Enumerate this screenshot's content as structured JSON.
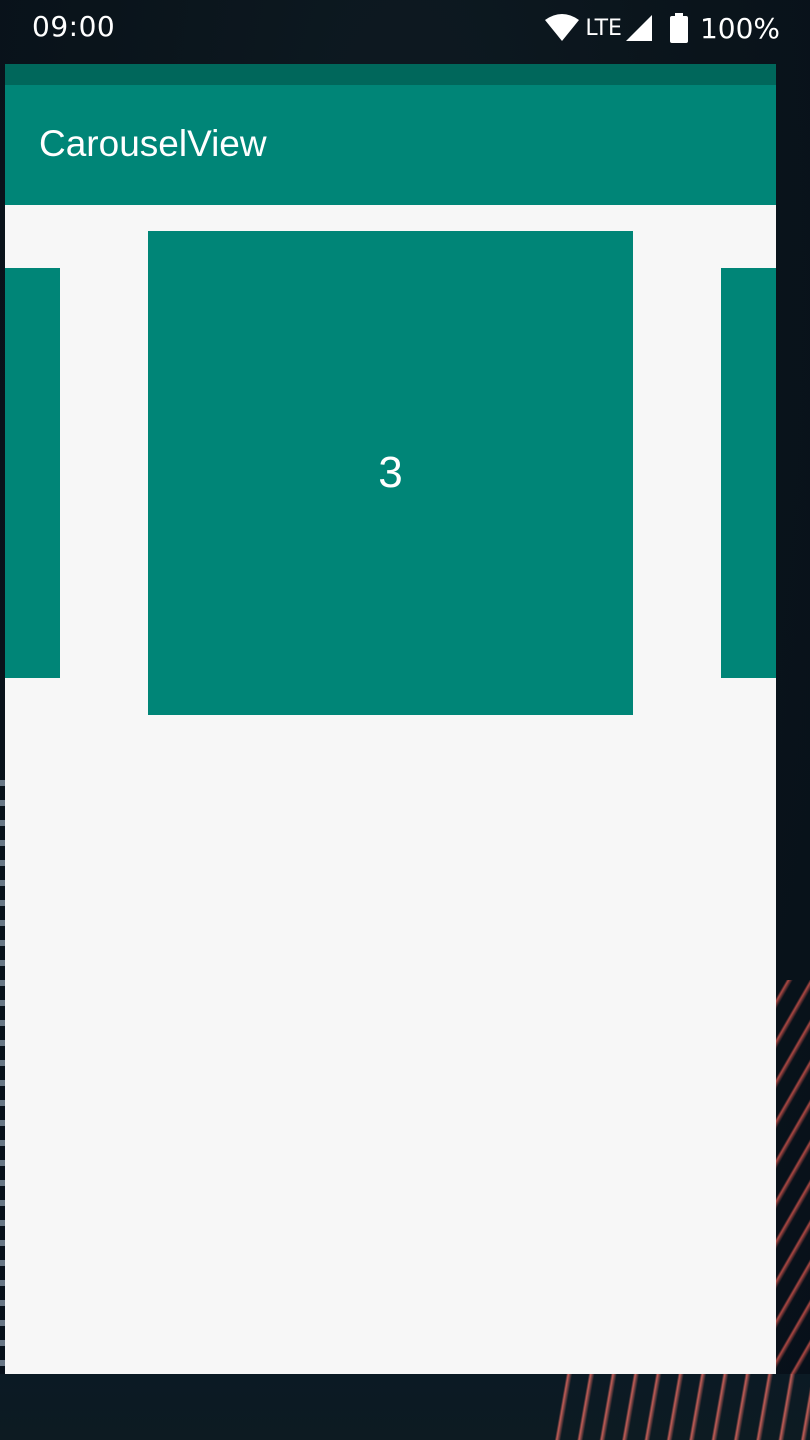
{
  "status_bar": {
    "time": "09:00",
    "network": "LTE",
    "battery": "100%",
    "icons": [
      "wifi-icon",
      "signal-icon",
      "battery-icon"
    ]
  },
  "app": {
    "title": "CarouselView"
  },
  "carousel": {
    "current_item": "3",
    "accent_color": "#008577",
    "dark_accent_color": "#00675b"
  }
}
